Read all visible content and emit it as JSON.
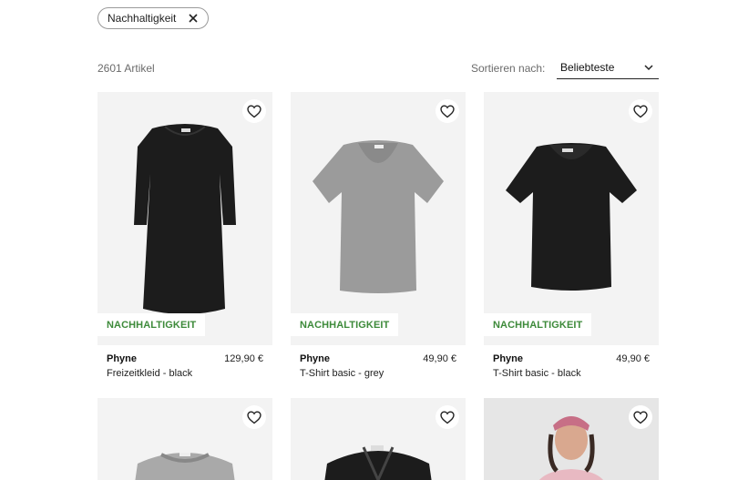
{
  "filter_chip": {
    "label": "Nachhaltigkeit",
    "remove_icon": "close-icon"
  },
  "results": {
    "count_text": "2601 Artikel"
  },
  "sort": {
    "label": "Sortieren nach:",
    "value": "Beliebteste",
    "icon": "chevron-down-icon"
  },
  "products": [
    {
      "brand": "Phyne",
      "name": "Freizeitkleid - black",
      "price": "129,90 €",
      "badge": "NACHHALTIGKEIT",
      "garment": "black dress"
    },
    {
      "brand": "Phyne",
      "name": "T-Shirt basic - grey",
      "price": "49,90 €",
      "badge": "NACHHALTIGKEIT",
      "garment": "grey t-shirt"
    },
    {
      "brand": "Phyne",
      "name": "T-Shirt basic - black",
      "price": "49,90 €",
      "badge": "NACHHALTIGKEIT",
      "garment": "black t-shirt"
    },
    {
      "garment": "grey sweater"
    },
    {
      "garment": "black jacket"
    },
    {
      "garment": "model in pink knit sweater"
    }
  ],
  "colors": {
    "badge_green": "#3d8a3a",
    "image_bg": "#f3f3f3",
    "black_garment": "#1c1c1c",
    "grey_garment": "#9b9b9b"
  }
}
